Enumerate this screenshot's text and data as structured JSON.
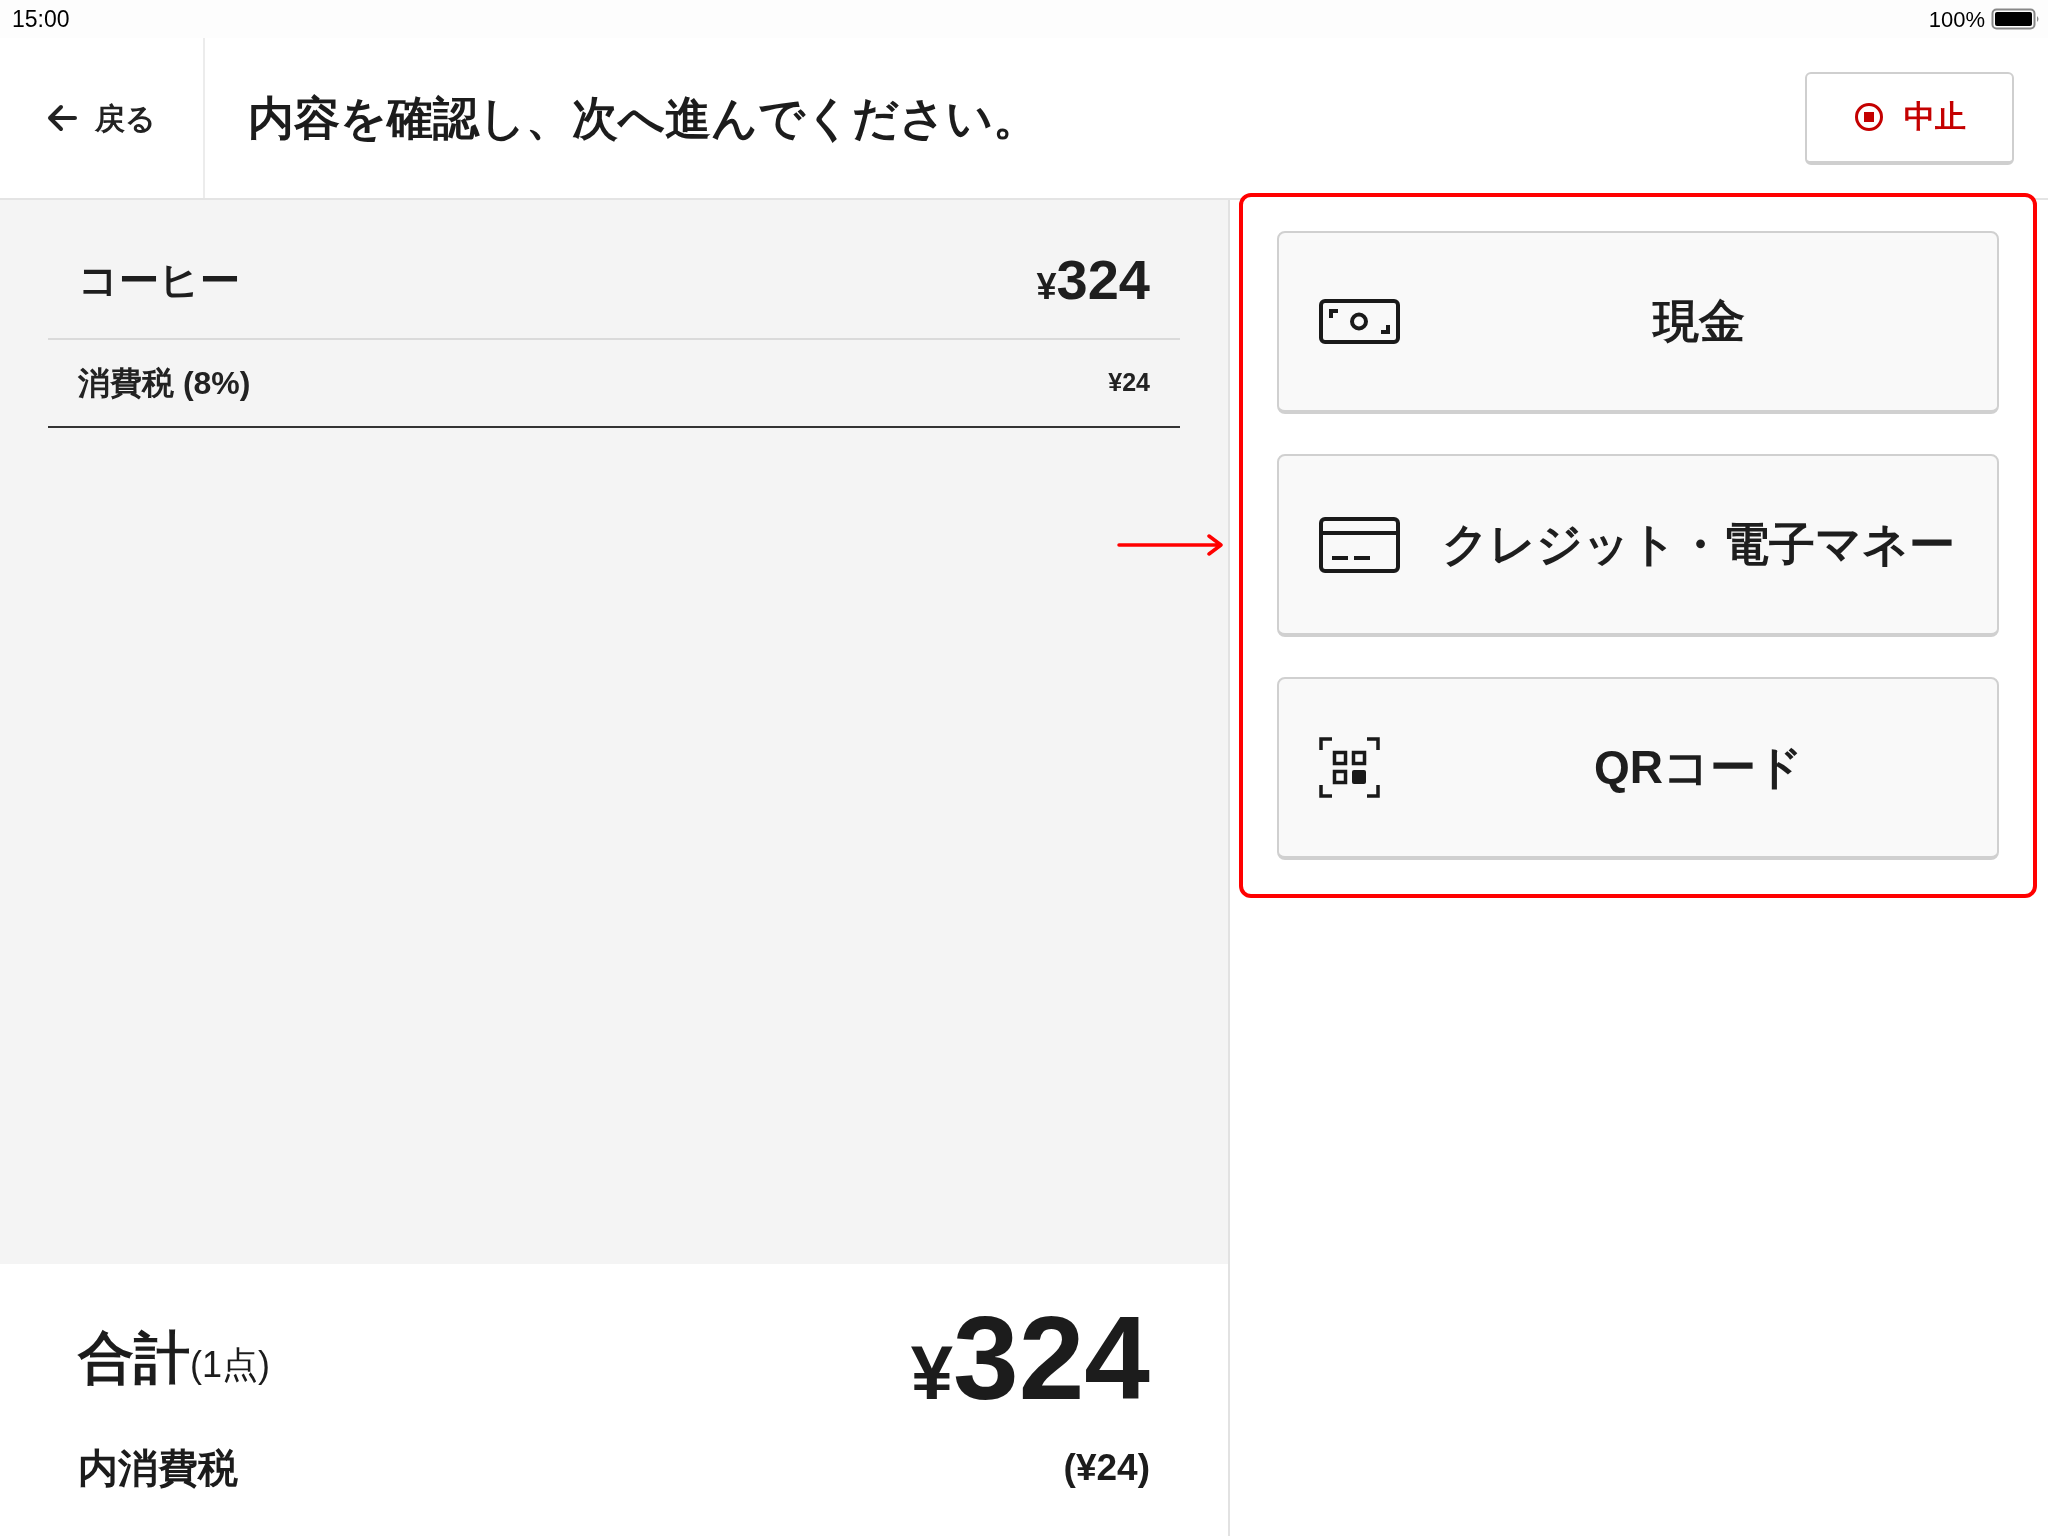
{
  "status_bar": {
    "time": "15:00",
    "battery": "100%"
  },
  "header": {
    "back_button": "戻る",
    "title": "内容を確認し、次へ進んでください。",
    "stop_button": "中止"
  },
  "order": {
    "items": [
      {
        "name": "コーヒー",
        "currency": "¥",
        "amount": "324"
      }
    ],
    "tax": {
      "label": "消費税 (8%)",
      "amount": "¥24"
    }
  },
  "total": {
    "label": "合計",
    "count": "(1点)",
    "currency": "¥",
    "amount": "324",
    "tax_label": "内消費税",
    "tax_amount": "(¥24)"
  },
  "payment_methods": [
    {
      "kind": "cash",
      "label": "現金"
    },
    {
      "kind": "card",
      "label": "クレジット・電子マネー"
    },
    {
      "kind": "qr",
      "label": "QRコード"
    }
  ]
}
